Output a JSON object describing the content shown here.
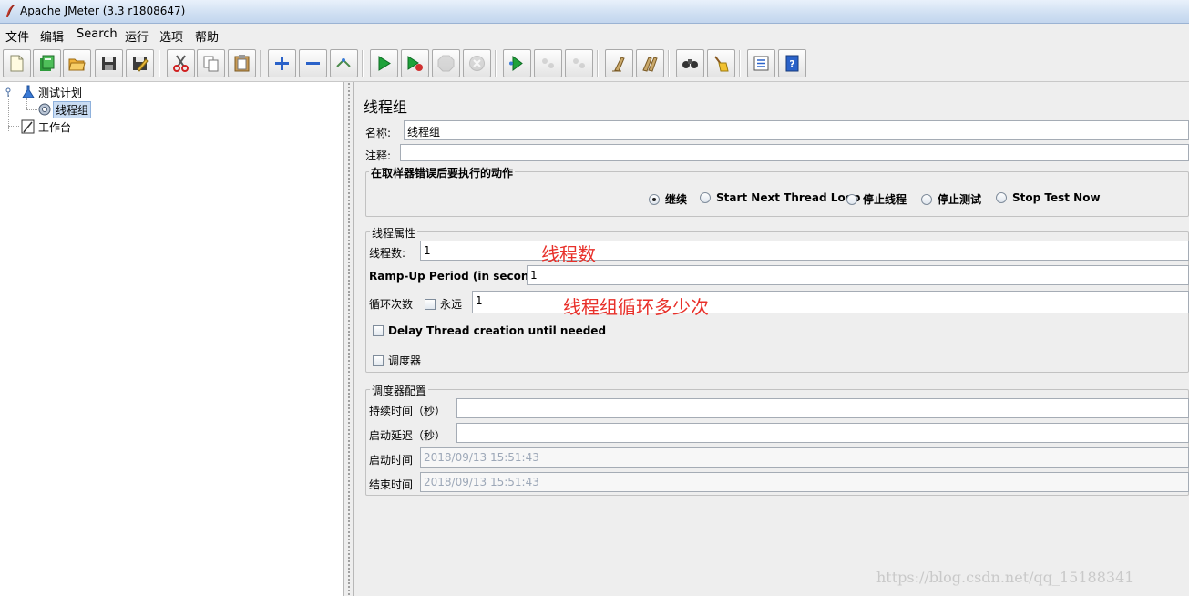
{
  "window": {
    "title": "Apache JMeter (3.3 r1808647)"
  },
  "menubar": {
    "items": [
      "文件",
      "编辑",
      "Search",
      "运行",
      "选项",
      "帮助"
    ]
  },
  "toolbar": {
    "buttons": [
      {
        "icon": "new-icon"
      },
      {
        "icon": "templates-icon"
      },
      {
        "icon": "open-icon"
      },
      {
        "icon": "save-icon"
      },
      {
        "icon": "revert-icon"
      },
      {
        "icon": "cut-icon"
      },
      {
        "icon": "copy-icon"
      },
      {
        "icon": "paste-icon"
      },
      {
        "icon": "expand-icon"
      },
      {
        "icon": "collapse-icon"
      },
      {
        "icon": "toggle-icon"
      },
      {
        "icon": "start-icon"
      },
      {
        "icon": "start-no-pause-icon"
      },
      {
        "icon": "stop-icon"
      },
      {
        "icon": "shutdown-icon"
      },
      {
        "icon": "remote-start-icon"
      },
      {
        "icon": "remote-stop-icon"
      },
      {
        "icon": "remote-shutdown-icon"
      },
      {
        "icon": "clear-icon"
      },
      {
        "icon": "clear-all-icon"
      },
      {
        "icon": "search-icon"
      },
      {
        "icon": "reset-search-icon"
      },
      {
        "icon": "function-helper-icon"
      },
      {
        "icon": "help-icon"
      }
    ]
  },
  "tree": {
    "nodes": [
      {
        "label": "测试计划",
        "icon": "test-plan-icon"
      },
      {
        "label": "线程组",
        "icon": "thread-group-icon",
        "selected": true
      },
      {
        "label": "工作台",
        "icon": "workbench-icon"
      }
    ]
  },
  "main": {
    "panel_title": "线程组",
    "name_label": "名称:",
    "name_value": "线程组",
    "comment_label": "注释:",
    "comment_value": "",
    "error_action": {
      "legend": "在取样器错误后要执行的动作",
      "options": [
        "继续",
        "Start Next Thread Loop",
        "停止线程",
        "停止测试",
        "Stop Test Now"
      ],
      "selected": "继续"
    },
    "thread_props": {
      "legend": "线程属性",
      "threads_label": "线程数:",
      "threads_value": "1",
      "rampup_label": "Ramp-Up Period (in seconds):",
      "rampup_value": "1",
      "loop_label": "循环次数",
      "forever_label": "永远",
      "forever_checked": false,
      "loop_value": "1",
      "delay_label": "Delay Thread creation until needed",
      "delay_checked": false,
      "scheduler_label": "调度器",
      "scheduler_checked": false
    },
    "scheduler_config": {
      "legend": "调度器配置",
      "duration_label": "持续时间（秒）",
      "duration_value": "",
      "startup_delay_label": "启动延迟（秒）",
      "startup_delay_value": "",
      "start_time_label": "启动时间",
      "start_time_value": "2018/09/13 15:51:43",
      "end_time_label": "结束时间",
      "end_time_value": "2018/09/13 15:51:43"
    },
    "annotations": {
      "threads": "线程数",
      "loop": "线程组循环多少次"
    }
  },
  "watermark": "https://blog.csdn.net/qq_15188341",
  "colors": {
    "annotation": "#e8302a",
    "selection": "#c9dcf3"
  }
}
